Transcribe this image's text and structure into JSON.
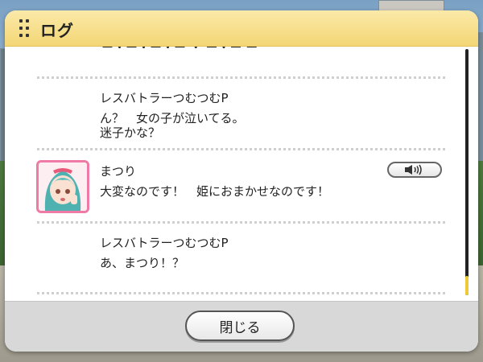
{
  "window": {
    "title": "ログ"
  },
  "log": {
    "cut_off_text": "ー・ー・ー・ー ・ ー・ー ー",
    "entries": [
      {
        "speaker": "レスバトラーつむつむP",
        "lines": [
          "ん？　女の子が泣いてる。",
          "迷子かな？"
        ],
        "has_avatar": false,
        "has_voice": false
      },
      {
        "speaker": "まつり",
        "lines": [
          "大変なのです！　姫におまかせなのです！"
        ],
        "has_avatar": true,
        "has_voice": true,
        "avatar_name": "matsuri-portrait-icon"
      },
      {
        "speaker": "レスバトラーつむつむP",
        "lines": [
          "あ、まつり！？"
        ],
        "has_avatar": false,
        "has_voice": false
      }
    ],
    "scroll_position": 0.97,
    "scroll_visible_fraction": 0.08
  },
  "footer": {
    "close_label": "閉じる"
  },
  "colors": {
    "header_bg": "#f3d675",
    "avatar_border": "#f07aa6",
    "scroll_thumb": "#f0c93a"
  }
}
